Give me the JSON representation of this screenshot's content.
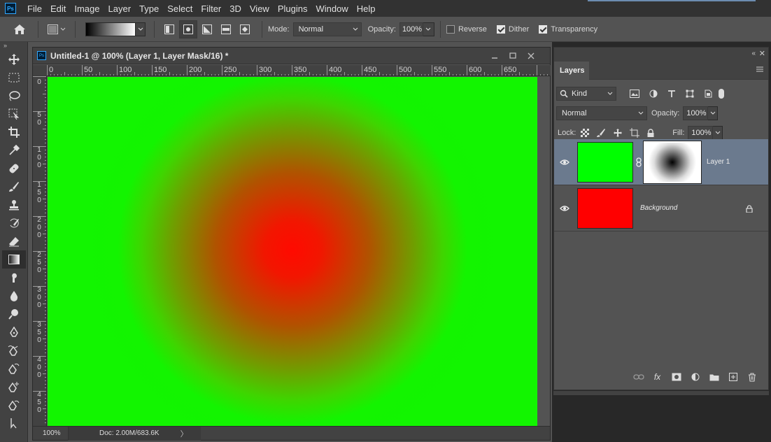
{
  "menubar": {
    "logo": "Ps",
    "items": [
      "File",
      "Edit",
      "Image",
      "Layer",
      "Type",
      "Select",
      "Filter",
      "3D",
      "View",
      "Plugins",
      "Window",
      "Help"
    ]
  },
  "options": {
    "mode_label": "Mode:",
    "mode_value": "Normal",
    "opacity_label": "Opacity:",
    "opacity_value": "100%",
    "reverse_label": "Reverse",
    "dither_label": "Dither",
    "transparency_label": "Transparency",
    "reverse_checked": false,
    "dither_checked": true,
    "transparency_checked": true
  },
  "toolbox": {
    "collapse": "»",
    "tools": [
      "move-tool",
      "marquee-tool",
      "lasso-tool",
      "object-select-tool",
      "crop-tool",
      "eyedropper-tool",
      "healing-brush-tool",
      "brush-tool",
      "clone-stamp-tool",
      "history-brush-tool",
      "eraser-tool",
      "gradient-tool",
      "smudge-tool",
      "blur-tool",
      "dodge-tool",
      "pen-tool",
      "freeform-pen-tool",
      "curvature-pen-tool",
      "add-anchor-tool",
      "delete-anchor-tool",
      "path-select-tool"
    ],
    "active": "gradient-tool"
  },
  "document": {
    "ps_icon": "Ps",
    "title": "Untitled-1 @ 100% (Layer 1, Layer Mask/16) *",
    "ruler_top": [
      "0",
      "50",
      "100",
      "150",
      "200",
      "250",
      "300",
      "350",
      "400",
      "450",
      "500",
      "550",
      "600",
      "650"
    ],
    "ruler_left": [
      "0",
      "5 0",
      "1 0 0",
      "1 5 0",
      "2 0 0",
      "2 5 0",
      "3 0 0",
      "3 5 0",
      "4 0 0",
      "4 5 0"
    ],
    "zoom": "100%",
    "doc_info": "Doc: 2.00M/683.6K",
    "status_arrow": "〉",
    "canvas": {
      "outer_color": "#12f500",
      "center_color": "#ff0a00"
    }
  },
  "layers_panel": {
    "tab": "Layers",
    "filter_label": "Kind",
    "blend_mode": "Normal",
    "opacity_label": "Opacity:",
    "opacity_value": "100%",
    "lock_label": "Lock:",
    "fill_label": "Fill:",
    "fill_value": "100%",
    "layers": [
      {
        "name": "Layer 1",
        "thumb_color": "#00ff00",
        "has_mask": true,
        "selected": true
      },
      {
        "name": "Background",
        "thumb_color": "#ff0000",
        "locked": true,
        "selected": false
      }
    ],
    "footer": {
      "fx": "fx"
    }
  }
}
